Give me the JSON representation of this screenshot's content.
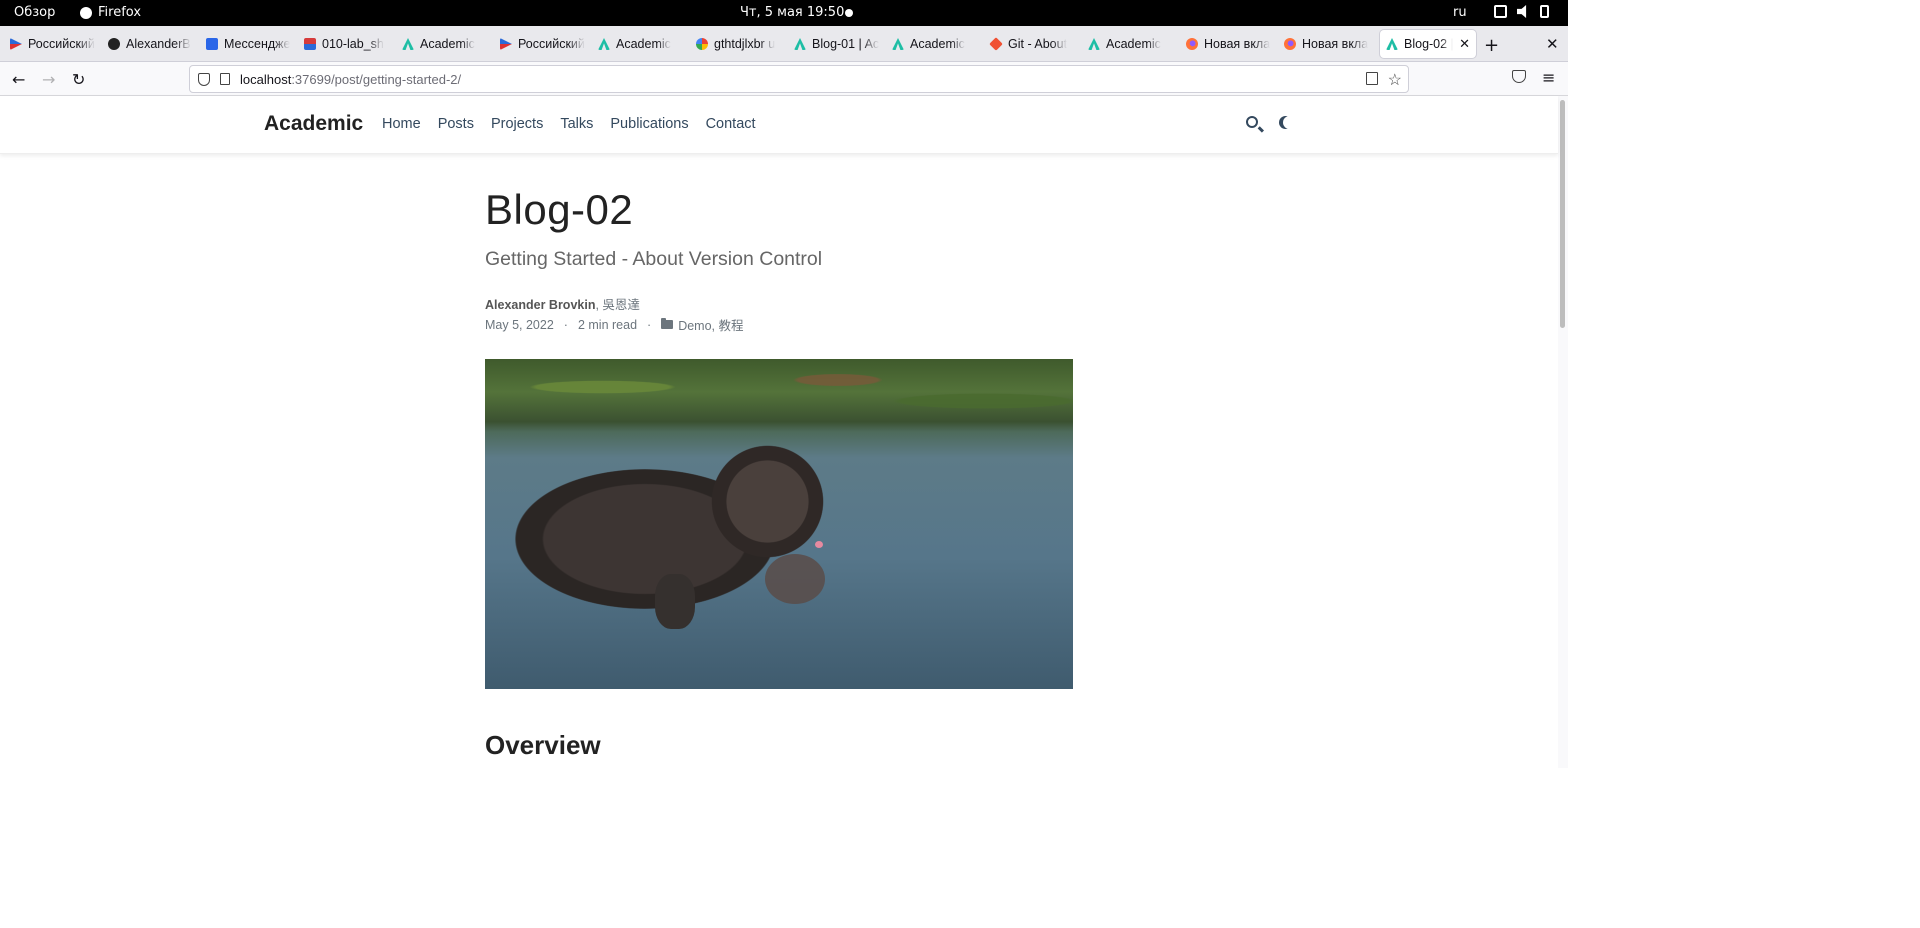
{
  "os": {
    "overview": "Обзор",
    "app_name": "Firefox",
    "clock": "Чт, 5 мая  19:50",
    "language": "ru"
  },
  "tabs": [
    {
      "label": "Российский",
      "icon": "russia-flag-icon"
    },
    {
      "label": "AlexanderB",
      "icon": "github-icon"
    },
    {
      "label": "Мессендже",
      "icon": "messenger-icon"
    },
    {
      "label": "010-lab_sh",
      "icon": "lab-icon"
    },
    {
      "label": "Academic",
      "icon": "academic-icon"
    },
    {
      "label": "Российский",
      "icon": "russia-flag-icon"
    },
    {
      "label": "Academic",
      "icon": "academic-icon"
    },
    {
      "label": "gthtdjlxbr u",
      "icon": "google-icon"
    },
    {
      "label": "Blog-01 | Ac",
      "icon": "academic-icon"
    },
    {
      "label": "Academic",
      "icon": "academic-icon"
    },
    {
      "label": "Git - About",
      "icon": "git-icon"
    },
    {
      "label": "Academic",
      "icon": "academic-icon"
    },
    {
      "label": "Новая вкла",
      "icon": "firefox-icon"
    },
    {
      "label": "Новая вкла",
      "icon": "firefox-icon"
    },
    {
      "label": "Blog-02 |",
      "icon": "academic-icon",
      "active": true
    }
  ],
  "url": {
    "host": "localhost",
    "path": ":37699/post/getting-started-2/"
  },
  "site": {
    "brand": "Academic",
    "nav": [
      "Home",
      "Posts",
      "Projects",
      "Talks",
      "Publications",
      "Contact"
    ]
  },
  "article": {
    "title": "Blog-02",
    "subtitle": "Getting Started - About Version Control",
    "author_primary": "Alexander Brovkin",
    "author_secondary": ", 吳恩達",
    "date": "May 5, 2022",
    "read_time": "2 min read",
    "categories": "Demo, 教程",
    "section_heading": "Overview"
  }
}
